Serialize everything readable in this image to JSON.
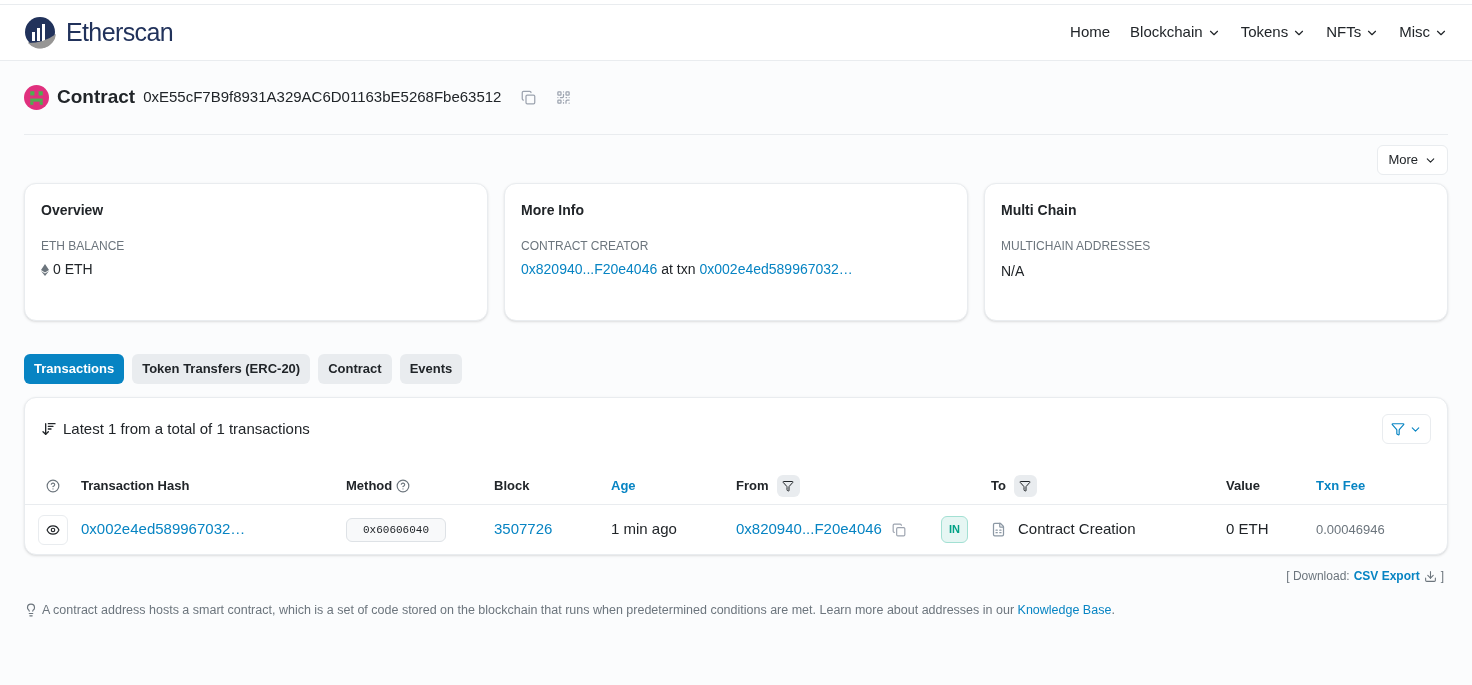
{
  "header": {
    "logo_text": "Etherscan",
    "nav": [
      {
        "label": "Home",
        "dropdown": false
      },
      {
        "label": "Blockchain",
        "dropdown": true
      },
      {
        "label": "Tokens",
        "dropdown": true
      },
      {
        "label": "NFTs",
        "dropdown": true
      },
      {
        "label": "Misc",
        "dropdown": true
      }
    ]
  },
  "title": {
    "label": "Contract",
    "address": "0xE55cF7B9f8931A329AC6D01163bE5268Fbe63512"
  },
  "more_button": "More",
  "cards": [
    {
      "title": "Overview",
      "label": "ETH BALANCE",
      "kind": "balance",
      "value": "0 ETH"
    },
    {
      "title": "More Info",
      "label": "CONTRACT CREATOR",
      "kind": "creator",
      "creator": "0x820940...F20e4046",
      "connector": "at txn",
      "txn": "0x002e4ed589967032…"
    },
    {
      "title": "Multi Chain",
      "label": "MULTICHAIN ADDRESSES",
      "kind": "text",
      "value": "N/A"
    }
  ],
  "tabs": [
    {
      "label": "Transactions",
      "selected": true
    },
    {
      "label": "Token Transfers (ERC-20)",
      "selected": false
    },
    {
      "label": "Contract",
      "selected": false
    },
    {
      "label": "Events",
      "selected": false
    }
  ],
  "table": {
    "summary": "Latest 1 from a total of 1 transactions",
    "columns": [
      {
        "label": "Transaction Hash",
        "link": false,
        "help": false,
        "filter": false
      },
      {
        "label": "Method",
        "link": false,
        "help": true,
        "filter": false
      },
      {
        "label": "Block",
        "link": false,
        "help": false,
        "filter": false
      },
      {
        "label": "Age",
        "link": true,
        "help": false,
        "filter": false
      },
      {
        "label": "From",
        "link": false,
        "help": false,
        "filter": true
      },
      {
        "label": "To",
        "link": false,
        "help": false,
        "filter": true
      },
      {
        "label": "Value",
        "link": false,
        "help": false,
        "filter": false
      },
      {
        "label": "Txn Fee",
        "link": true,
        "help": false,
        "filter": false
      }
    ],
    "rows": [
      {
        "hash": "0x002e4ed589967032…",
        "method": "0x60606040",
        "block": "3507726",
        "age": "1 min ago",
        "from": "0x820940...F20e4046",
        "direction": "IN",
        "to": "Contract Creation",
        "value": "0 ETH",
        "fee": "0.00046946"
      }
    ]
  },
  "download": {
    "prefix": "[ Download:",
    "link": "CSV Export",
    "suffix": "]"
  },
  "note": {
    "text": "A contract address hosts a smart contract, which is a set of code stored on the blockchain that runs when predetermined conditions are met. Learn more about addresses in our",
    "link": "Knowledge Base",
    "end": "."
  }
}
